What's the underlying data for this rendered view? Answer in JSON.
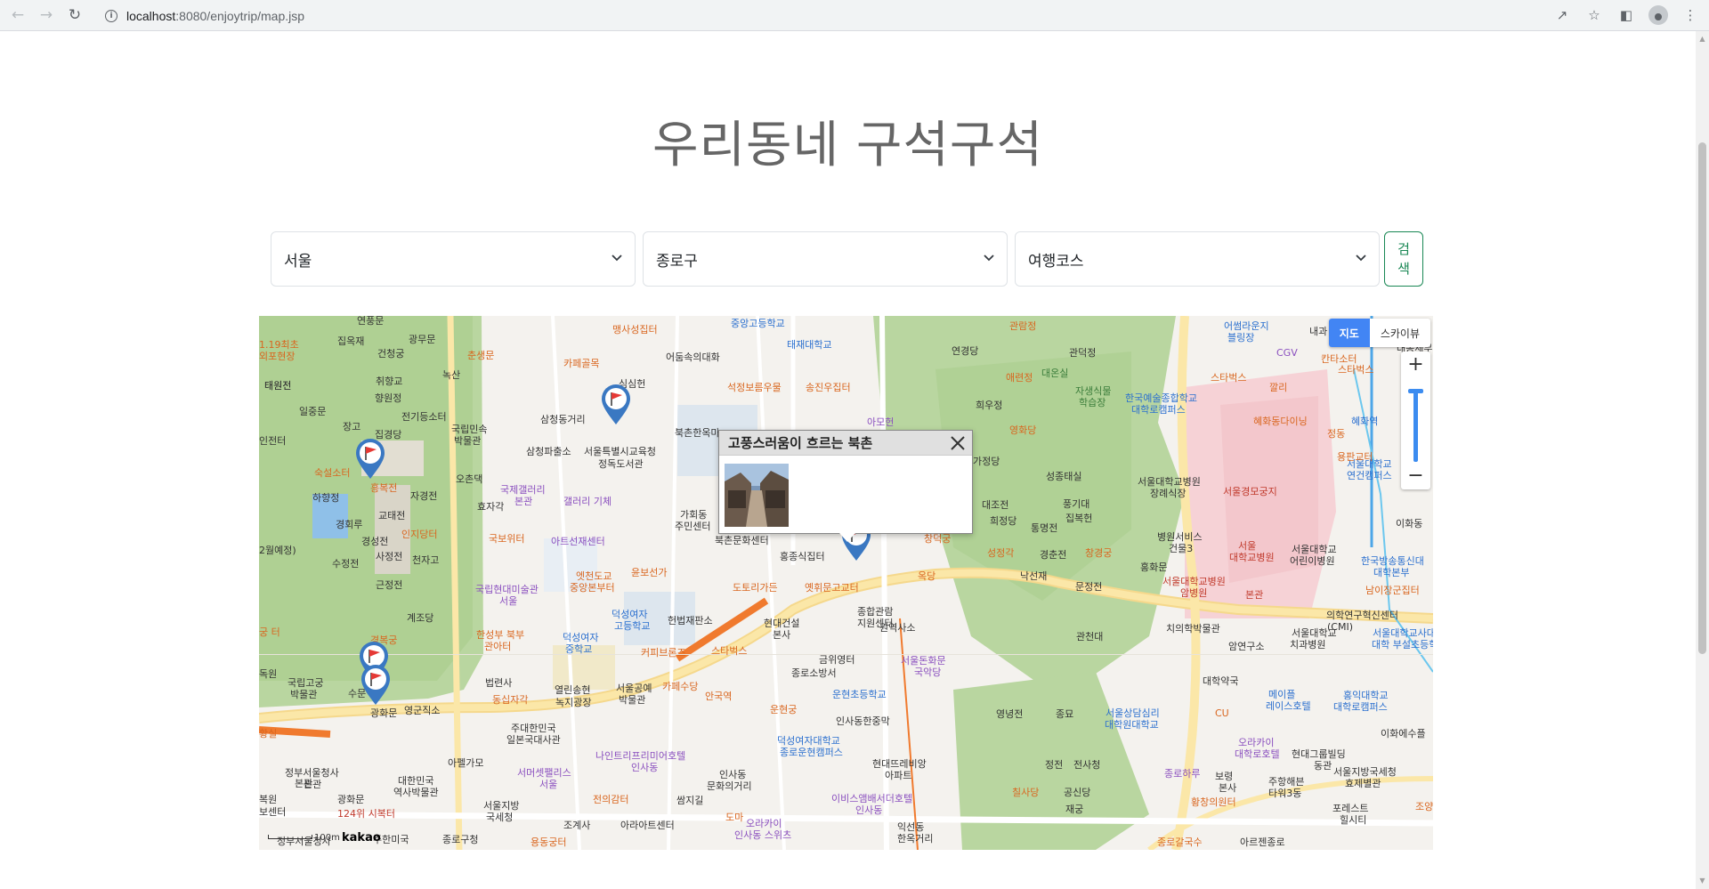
{
  "browser": {
    "url_host": "localhost",
    "url_path": ":8080/enjoytrip/map.jsp"
  },
  "page": {
    "title": "우리동네 구석구석"
  },
  "search": {
    "sido": "서울",
    "gugun": "종로구",
    "content_type": "여행코스",
    "button_line1": "검",
    "button_line2": "색"
  },
  "map": {
    "map_type_map": "지도",
    "map_type_sky": "스카이뷰",
    "zoom_in": "+",
    "zoom_out": "−",
    "scale": "100m",
    "logo": "kakao",
    "infowindow": {
      "title": "고풍스러움이 흐르는 북촌"
    },
    "labels": [
      {
        "t": "연풍문"
      },
      {
        "t": "집옥재"
      },
      {
        "t": "광무문"
      },
      {
        "t": "건청궁"
      },
      {
        "t": "춘생문"
      },
      {
        "t": "녹산"
      },
      {
        "t": "향원정"
      },
      {
        "t": "취향교"
      },
      {
        "t": "태원전"
      },
      {
        "t": "일중문"
      },
      {
        "t": "전기등소터"
      },
      {
        "t": "국립민속"
      },
      {
        "t": "박물관"
      },
      {
        "t": "장고"
      },
      {
        "t": "집경당"
      },
      {
        "t": "숙설소터"
      },
      {
        "t": "흥복전"
      },
      {
        "t": "오촌댁"
      },
      {
        "t": "하향정"
      },
      {
        "t": "자경전"
      },
      {
        "t": "교태전"
      },
      {
        "t": "효자각"
      },
      {
        "t": "경회루"
      },
      {
        "t": "인지당터"
      },
      {
        "t": "경성전"
      },
      {
        "t": "사정전"
      },
      {
        "t": "천자고"
      },
      {
        "t": "수정전"
      },
      {
        "t": "근정전"
      },
      {
        "t": "계조당"
      },
      {
        "t": "경복궁"
      },
      {
        "t": "국립고궁"
      },
      {
        "t": "박물관"
      },
      {
        "t": "수문"
      },
      {
        "t": "영군직소"
      },
      {
        "t": "광화문"
      },
      {
        "t": "맹사성집터"
      },
      {
        "t": "카페골목"
      },
      {
        "t": "어둠속의대화"
      },
      {
        "t": "심심헌"
      },
      {
        "t": "삼청동거리"
      },
      {
        "t": "삼청파출소"
      },
      {
        "t": "서울특별시교육청"
      },
      {
        "t": "정독도서관"
      },
      {
        "t": "국제갤러리"
      },
      {
        "t": "본관"
      },
      {
        "t": "갤러리 기체"
      },
      {
        "t": "아트선재센터"
      },
      {
        "t": "국보위터"
      },
      {
        "t": "가회동"
      },
      {
        "t": "주민센터"
      },
      {
        "t": "북촌한옥마"
      },
      {
        "t": "중앙고등학교"
      },
      {
        "t": "태재대학교"
      },
      {
        "t": "석정보름우물"
      },
      {
        "t": "송진우집터"
      },
      {
        "t": "아모헌"
      },
      {
        "t": "북촌문화센터"
      },
      {
        "t": "홍종식집터"
      },
      {
        "t": "윤보선가"
      },
      {
        "t": "엣천도교"
      },
      {
        "t": "중앙본부터"
      },
      {
        "t": "국립현대미술관"
      },
      {
        "t": "서울"
      },
      {
        "t": "덕성여자"
      },
      {
        "t": "고등학교"
      },
      {
        "t": "헌법재판소"
      },
      {
        "t": "도토리가든"
      },
      {
        "t": "옛휘문고교터"
      },
      {
        "t": "현대건설"
      },
      {
        "t": "본사"
      },
      {
        "t": "종합관람"
      },
      {
        "t": "지원센터"
      },
      {
        "t": "원역사소"
      },
      {
        "t": "한성부 북부"
      },
      {
        "t": "관아터"
      },
      {
        "t": "덕성여자"
      },
      {
        "t": "중학교"
      },
      {
        "t": "커피브론즈"
      },
      {
        "t": "스타벅스"
      },
      {
        "t": "금위영터"
      },
      {
        "t": "서울돈화문"
      },
      {
        "t": "국악당"
      },
      {
        "t": "동십자각"
      },
      {
        "t": "법련사"
      },
      {
        "t": "열린송현"
      },
      {
        "t": "녹지광장"
      },
      {
        "t": "서울공예"
      },
      {
        "t": "박물관"
      },
      {
        "t": "카페수당"
      },
      {
        "t": "안국역"
      },
      {
        "t": "종로소방서"
      },
      {
        "t": "운현초등학교"
      },
      {
        "t": "운현궁"
      },
      {
        "t": "인사동한중막"
      },
      {
        "t": "주대한민국"
      },
      {
        "t": "일본국대사관"
      },
      {
        "t": "아펠가모"
      },
      {
        "t": "나인트리프리미어호텔"
      },
      {
        "t": "인사동"
      },
      {
        "t": "서머셋팰리스"
      },
      {
        "t": "서울"
      },
      {
        "t": "인사동"
      },
      {
        "t": "문화의거리"
      },
      {
        "t": "덕성여자대학교"
      },
      {
        "t": "종로운현캠퍼스"
      },
      {
        "t": "현대뜨레비앙"
      },
      {
        "t": "아파트"
      },
      {
        "t": "정부서울청사"
      },
      {
        "t": "본관"
      },
      {
        "t": "대한민국"
      },
      {
        "t": "역사박물관"
      },
      {
        "t": "서울지방"
      },
      {
        "t": "국세청"
      },
      {
        "t": "전의감터"
      },
      {
        "t": "쌈지길"
      },
      {
        "t": "이비스앰배서더호텔"
      },
      {
        "t": "인사동"
      },
      {
        "t": "광화문"
      },
      {
        "t": "124위 시복터"
      },
      {
        "t": "조계사"
      },
      {
        "t": "도마"
      },
      {
        "t": "오라카이"
      },
      {
        "t": "인사동 스위츠"
      },
      {
        "t": "아라아트센터"
      },
      {
        "t": "익선동"
      },
      {
        "t": "한옥거리"
      },
      {
        "t": "종로구청"
      },
      {
        "t": "용동궁터"
      },
      {
        "t": "정부서울청사"
      },
      {
        "t": "주한미국"
      },
      {
        "t": "관람정"
      },
      {
        "t": "연경당"
      },
      {
        "t": "관덕정"
      },
      {
        "t": "애련정"
      },
      {
        "t": "대온실"
      },
      {
        "t": "자생식물"
      },
      {
        "t": "학습장"
      },
      {
        "t": "희우정"
      },
      {
        "t": "영화당"
      },
      {
        "t": "가정당"
      },
      {
        "t": "성종태실"
      },
      {
        "t": "대조전"
      },
      {
        "t": "풍기대"
      },
      {
        "t": "희정당"
      },
      {
        "t": "통명전"
      },
      {
        "t": "집복헌"
      },
      {
        "t": "창덕궁"
      },
      {
        "t": "성정각"
      },
      {
        "t": "경춘전"
      },
      {
        "t": "창경궁"
      },
      {
        "t": "낙선재"
      },
      {
        "t": "문정전"
      },
      {
        "t": "옥당"
      },
      {
        "t": "관천대"
      },
      {
        "t": "영녕전"
      },
      {
        "t": "종묘"
      },
      {
        "t": "정전"
      },
      {
        "t": "전사청"
      },
      {
        "t": "공신당"
      },
      {
        "t": "재궁"
      },
      {
        "t": "칠사당"
      },
      {
        "t": "서울상담심리"
      },
      {
        "t": "대학원대학교"
      },
      {
        "t": "어썸라운지"
      },
      {
        "t": "블링장"
      },
      {
        "t": "한국예술종합학교"
      },
      {
        "t": "대학로캠퍼스"
      },
      {
        "t": "스타벅스"
      },
      {
        "t": "깔리"
      },
      {
        "t": "혜화동다이닝"
      },
      {
        "t": "CGV"
      },
      {
        "t": "서울대학교병원"
      },
      {
        "t": "장례식장"
      },
      {
        "t": "서울경모궁지"
      },
      {
        "t": "병원서비스"
      },
      {
        "t": "건물3"
      },
      {
        "t": "서울"
      },
      {
        "t": "대학교병원"
      },
      {
        "t": "서울대학교"
      },
      {
        "t": "어린이병원"
      },
      {
        "t": "서울대학교병원"
      },
      {
        "t": "암병원"
      },
      {
        "t": "본관"
      },
      {
        "t": "홍화문"
      },
      {
        "t": "치의학박물관"
      },
      {
        "t": "서울대학교"
      },
      {
        "t": "치과병원"
      },
      {
        "t": "암연구소"
      },
      {
        "t": "의학연구혁신센터"
      },
      {
        "t": "(CMI)"
      },
      {
        "t": "대학약국"
      },
      {
        "t": "메이플"
      },
      {
        "t": "레이스호텔"
      },
      {
        "t": "홍익대학교"
      },
      {
        "t": "대학로캠퍼스"
      },
      {
        "t": "CU"
      },
      {
        "t": "오라카이"
      },
      {
        "t": "대학로호텔"
      },
      {
        "t": "현대그룹빌딩"
      },
      {
        "t": "동관"
      },
      {
        "t": "이화에수플"
      },
      {
        "t": "종로하루"
      },
      {
        "t": "보령"
      },
      {
        "t": "본사"
      },
      {
        "t": "주항해븐"
      },
      {
        "t": "타워3동"
      },
      {
        "t": "서울지방국세청"
      },
      {
        "t": "효제별관"
      },
      {
        "t": "황창의원터"
      },
      {
        "t": "포레스트"
      },
      {
        "t": "힐시티"
      },
      {
        "t": "종로갈국수"
      },
      {
        "t": "아르젠종로"
      },
      {
        "t": "한국방송통신대"
      },
      {
        "t": "대학본부"
      },
      {
        "t": "남이장군집터"
      },
      {
        "t": "서울대학교"
      },
      {
        "t": "연건캠퍼스"
      },
      {
        "t": "스타벅스"
      },
      {
        "t": "혜화역"
      },
      {
        "t": "정동"
      },
      {
        "t": "용판교터"
      },
      {
        "t": "칸타소터"
      },
      {
        "t": "이화동"
      },
      {
        "t": "서울대학교사대"
      },
      {
        "t": "대학 부설초등학"
      },
      {
        "t": "조양"
      },
      {
        "t": "내과"
      },
      {
        "t": "1.19최초"
      },
      {
        "t": "외포현장"
      },
      {
        "t": "태원전"
      },
      {
        "t": "인전터"
      },
      {
        "t": "2월예정)"
      },
      {
        "t": "궁 터"
      },
      {
        "t": "독원"
      },
      {
        "t": "본관"
      },
      {
        "t": "복원"
      },
      {
        "t": "보센터"
      },
      {
        "t": "황실"
      },
      {
        "t": "대동세무"
      }
    ]
  }
}
